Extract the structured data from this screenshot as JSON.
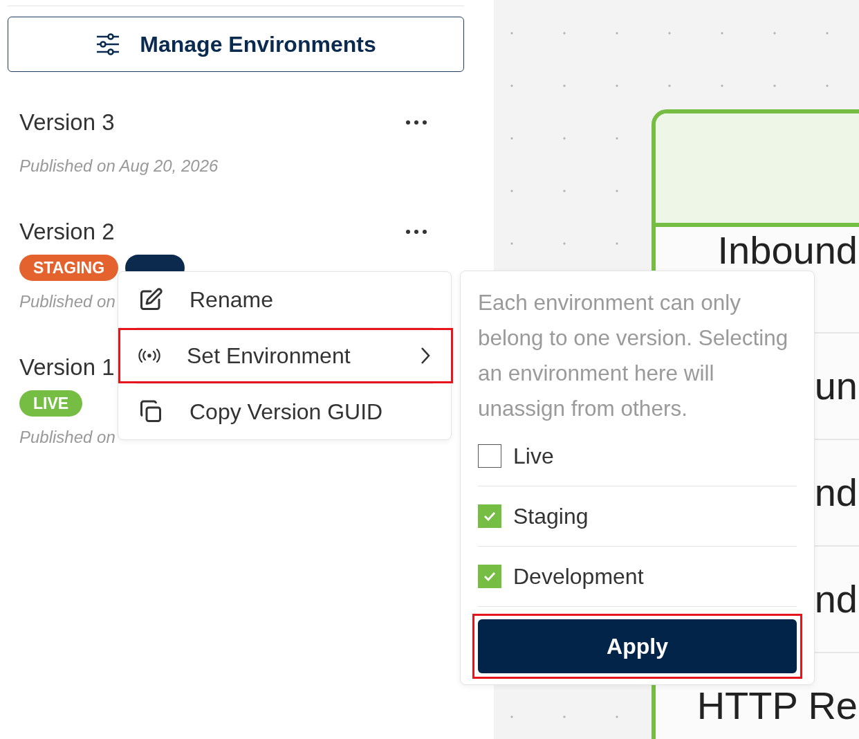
{
  "sidebar": {
    "manage_button": {
      "label": "Manage Environments"
    },
    "versions": [
      {
        "title": "Version 3",
        "published": "Published on Aug 20, 2026"
      },
      {
        "title": "Version 2",
        "badges": [
          {
            "label": "STAGING",
            "color": "#e3622e"
          },
          {
            "color": "#0b2a4e"
          }
        ],
        "published": "Published on"
      },
      {
        "title": "Version 1",
        "badges": [
          {
            "label": "LIVE",
            "color": "#76bd43"
          }
        ],
        "published": "Published on"
      }
    ]
  },
  "context_menu": {
    "items": [
      {
        "kind": "rename",
        "label": "Rename",
        "highlighted": false
      },
      {
        "kind": "environment",
        "label": "Set Environment",
        "highlighted": true
      },
      {
        "kind": "copy",
        "label": "Copy Version GUID",
        "highlighted": false
      }
    ]
  },
  "environment_popover": {
    "note": "Each environment can only belong to one version. Selecting an environment here will unassign from others.",
    "options": [
      {
        "label": "Live",
        "checked": false
      },
      {
        "label": "Staging",
        "checked": true
      },
      {
        "label": "Development",
        "checked": true
      }
    ],
    "apply_button": {
      "label": "Apply",
      "highlighted": true
    }
  },
  "canvas": {
    "node_rows": [
      "Inbound",
      "un",
      "nd",
      "nd",
      "HTTP Re"
    ]
  }
}
